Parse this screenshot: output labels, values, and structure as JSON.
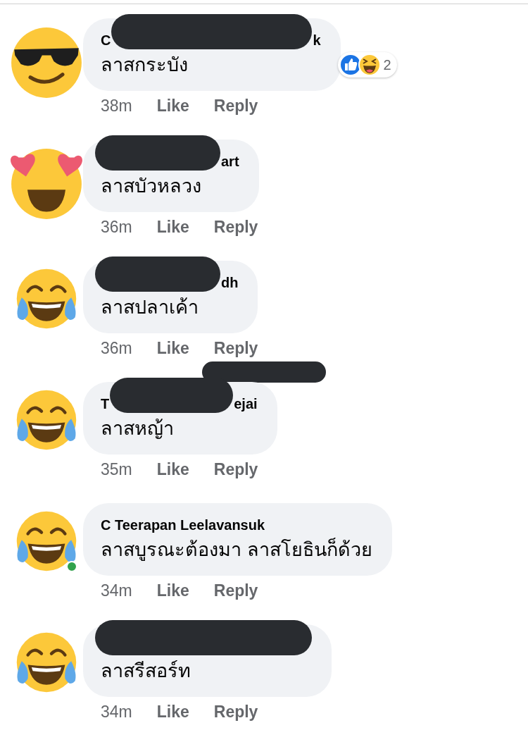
{
  "comments": [
    {
      "avatar": {
        "kind": "sunglasses",
        "online": false
      },
      "name": {
        "redacted": true,
        "before": "C",
        "after": "k"
      },
      "text": "ลาสกระบัง",
      "reactions": {
        "count": "2"
      },
      "meta": {
        "time": "38m",
        "like": "Like",
        "reply": "Reply"
      }
    },
    {
      "avatar": {
        "kind": "heart_eyes",
        "online": false
      },
      "name": {
        "redacted": true,
        "after": "art"
      },
      "text": "ลาสบัวหลวง",
      "meta": {
        "time": "36m",
        "like": "Like",
        "reply": "Reply"
      }
    },
    {
      "avatar": {
        "kind": "tears_of_joy",
        "online": false
      },
      "name": {
        "redacted": true,
        "after": "dh"
      },
      "text": "ลาสปลาเค้า",
      "meta": {
        "time": "36m",
        "like": "Like",
        "reply": "Reply",
        "redacted": true
      }
    },
    {
      "avatar": {
        "kind": "tears_of_joy",
        "online": false
      },
      "name": {
        "redacted": true,
        "before": "T",
        "after": "ejai"
      },
      "text": "ลาสหญ้า",
      "meta": {
        "time": "35m",
        "like": "Like",
        "reply": "Reply"
      }
    },
    {
      "avatar": {
        "kind": "tears_of_joy",
        "online": true
      },
      "name": {
        "redacted": false,
        "before": "C Teerapan Leelavansuk"
      },
      "text": "ลาสบูรณะต้องมา ลาสโยธินก็ด้วย",
      "meta": {
        "time": "34m",
        "like": "Like",
        "reply": "Reply"
      }
    },
    {
      "avatar": {
        "kind": "tears_of_joy",
        "online": false
      },
      "name": {
        "redacted": true
      },
      "text": "ลาสรีสอร์ท",
      "meta": {
        "time": "34m",
        "like": "Like",
        "reply": "Reply"
      }
    }
  ]
}
